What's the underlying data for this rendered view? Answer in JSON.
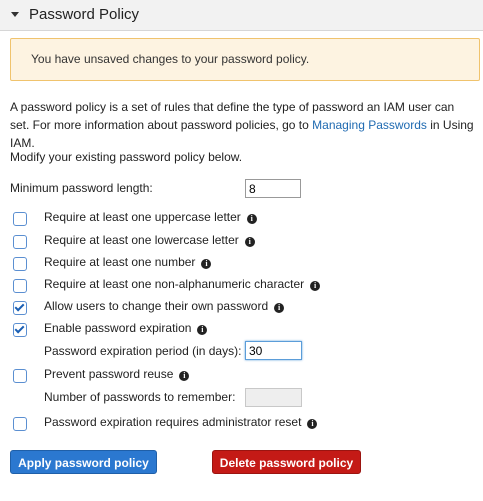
{
  "header": {
    "title": "Password Policy"
  },
  "alert": {
    "text": "You have unsaved changes to your password policy."
  },
  "description": {
    "text_before": "A password policy is a set of rules that define the type of password an IAM user can set. For more information about password policies, go to ",
    "link": "Managing Passwords",
    "text_after": " in Using IAM."
  },
  "modify_text": "Modify your existing password policy below.",
  "min_length": {
    "label": "Minimum password length:",
    "value": "8"
  },
  "options": [
    {
      "label": "Require at least one uppercase letter",
      "checked": false
    },
    {
      "label": "Require at least one lowercase letter",
      "checked": false
    },
    {
      "label": "Require at least one number",
      "checked": false
    },
    {
      "label": "Require at least one non-alphanumeric character",
      "checked": false
    },
    {
      "label": "Allow users to change their own password",
      "checked": true
    },
    {
      "label": "Enable password expiration",
      "checked": true
    },
    {
      "label": "Prevent password reuse",
      "checked": false
    },
    {
      "label": "Password expiration requires administrator reset",
      "checked": false
    }
  ],
  "expiration_period": {
    "label": "Password expiration period (in days):",
    "value": "30"
  },
  "reuse_count": {
    "label": "Number of passwords to remember:",
    "value": ""
  },
  "buttons": {
    "apply": "Apply password policy",
    "delete": "Delete password policy"
  },
  "colors": {
    "link": "#1f6ab1",
    "apply": "#2b78d0",
    "delete": "#c41a16",
    "alert_bg": "#fdf3e1",
    "alert_border": "#f0c36d"
  },
  "icons": {
    "info": "info-icon",
    "caret": "caret-down-icon",
    "check": "check-icon"
  }
}
